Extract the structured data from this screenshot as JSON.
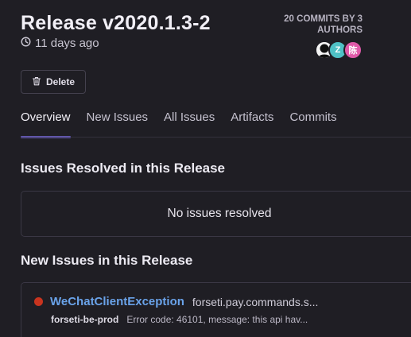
{
  "release": {
    "title": "Release v2020.1.3-2",
    "age": "11 days ago",
    "commits_summary": "20 COMMITS BY 3 AUTHORS",
    "authors": [
      {
        "initial": "",
        "color": "#f4f4f4"
      },
      {
        "initial": "Z",
        "color": "#4fc1c5"
      },
      {
        "initial": "陈",
        "color": "#e05aa9"
      }
    ]
  },
  "actions": {
    "delete_label": "Delete"
  },
  "tabs": [
    {
      "label": "Overview",
      "active": true
    },
    {
      "label": "New Issues",
      "active": false
    },
    {
      "label": "All Issues",
      "active": false
    },
    {
      "label": "Artifacts",
      "active": false
    },
    {
      "label": "Commits",
      "active": false
    }
  ],
  "sections": {
    "resolved": {
      "heading": "Issues Resolved in this Release",
      "empty_text": "No issues resolved"
    },
    "new_issues": {
      "heading": "New Issues in this Release",
      "items": [
        {
          "title": "WeChatClientException",
          "culprit": "forseti.pay.commands.s...",
          "project": "forseti-be-prod",
          "message": "Error code: 46101, message: this api hav...",
          "status_color": "#c8341f"
        }
      ]
    }
  },
  "colors": {
    "accent": "#6c5fc7",
    "link": "#6aa3ea",
    "background": "#1f1e24",
    "error": "#c8341f"
  }
}
